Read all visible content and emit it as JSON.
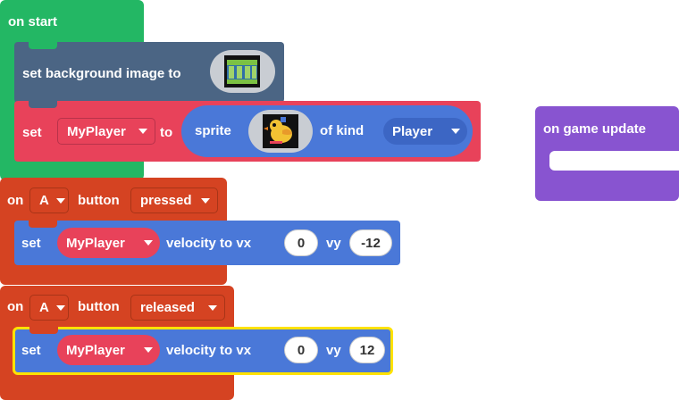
{
  "colors": {
    "events_green": "#23b764",
    "scene_slate": "#4b6584",
    "sprites_red": "#e8425a",
    "sprites_blue": "#4a78d8",
    "controller_orange": "#d54322",
    "game_purple": "#8854d0",
    "selection_yellow": "#ffe200"
  },
  "on_start": {
    "label": "on start",
    "set_background": {
      "label": "set background image to",
      "image_icon": "background-tiles-image"
    },
    "set_sprite": {
      "set_label": "set",
      "variable": "MyPlayer",
      "to_label": "to",
      "sprite_label": "sprite",
      "sprite_icon": "duck-sprite-image",
      "of_kind_label": "of kind",
      "kind": "Player"
    }
  },
  "on_game_update": {
    "label": "on game update"
  },
  "button_pressed": {
    "on_label": "on",
    "button": "A",
    "button_label": "button",
    "event": "pressed",
    "set_velocity": {
      "set_label": "set",
      "variable": "MyPlayer",
      "velocity_label": "velocity to vx",
      "vx": "0",
      "vy_label": "vy",
      "vy": "-12"
    }
  },
  "button_released": {
    "on_label": "on",
    "button": "A",
    "button_label": "button",
    "event": "released",
    "set_velocity": {
      "set_label": "set",
      "variable": "MyPlayer",
      "velocity_label": "velocity to vx",
      "vx": "0",
      "vy_label": "vy",
      "vy": "12"
    }
  }
}
